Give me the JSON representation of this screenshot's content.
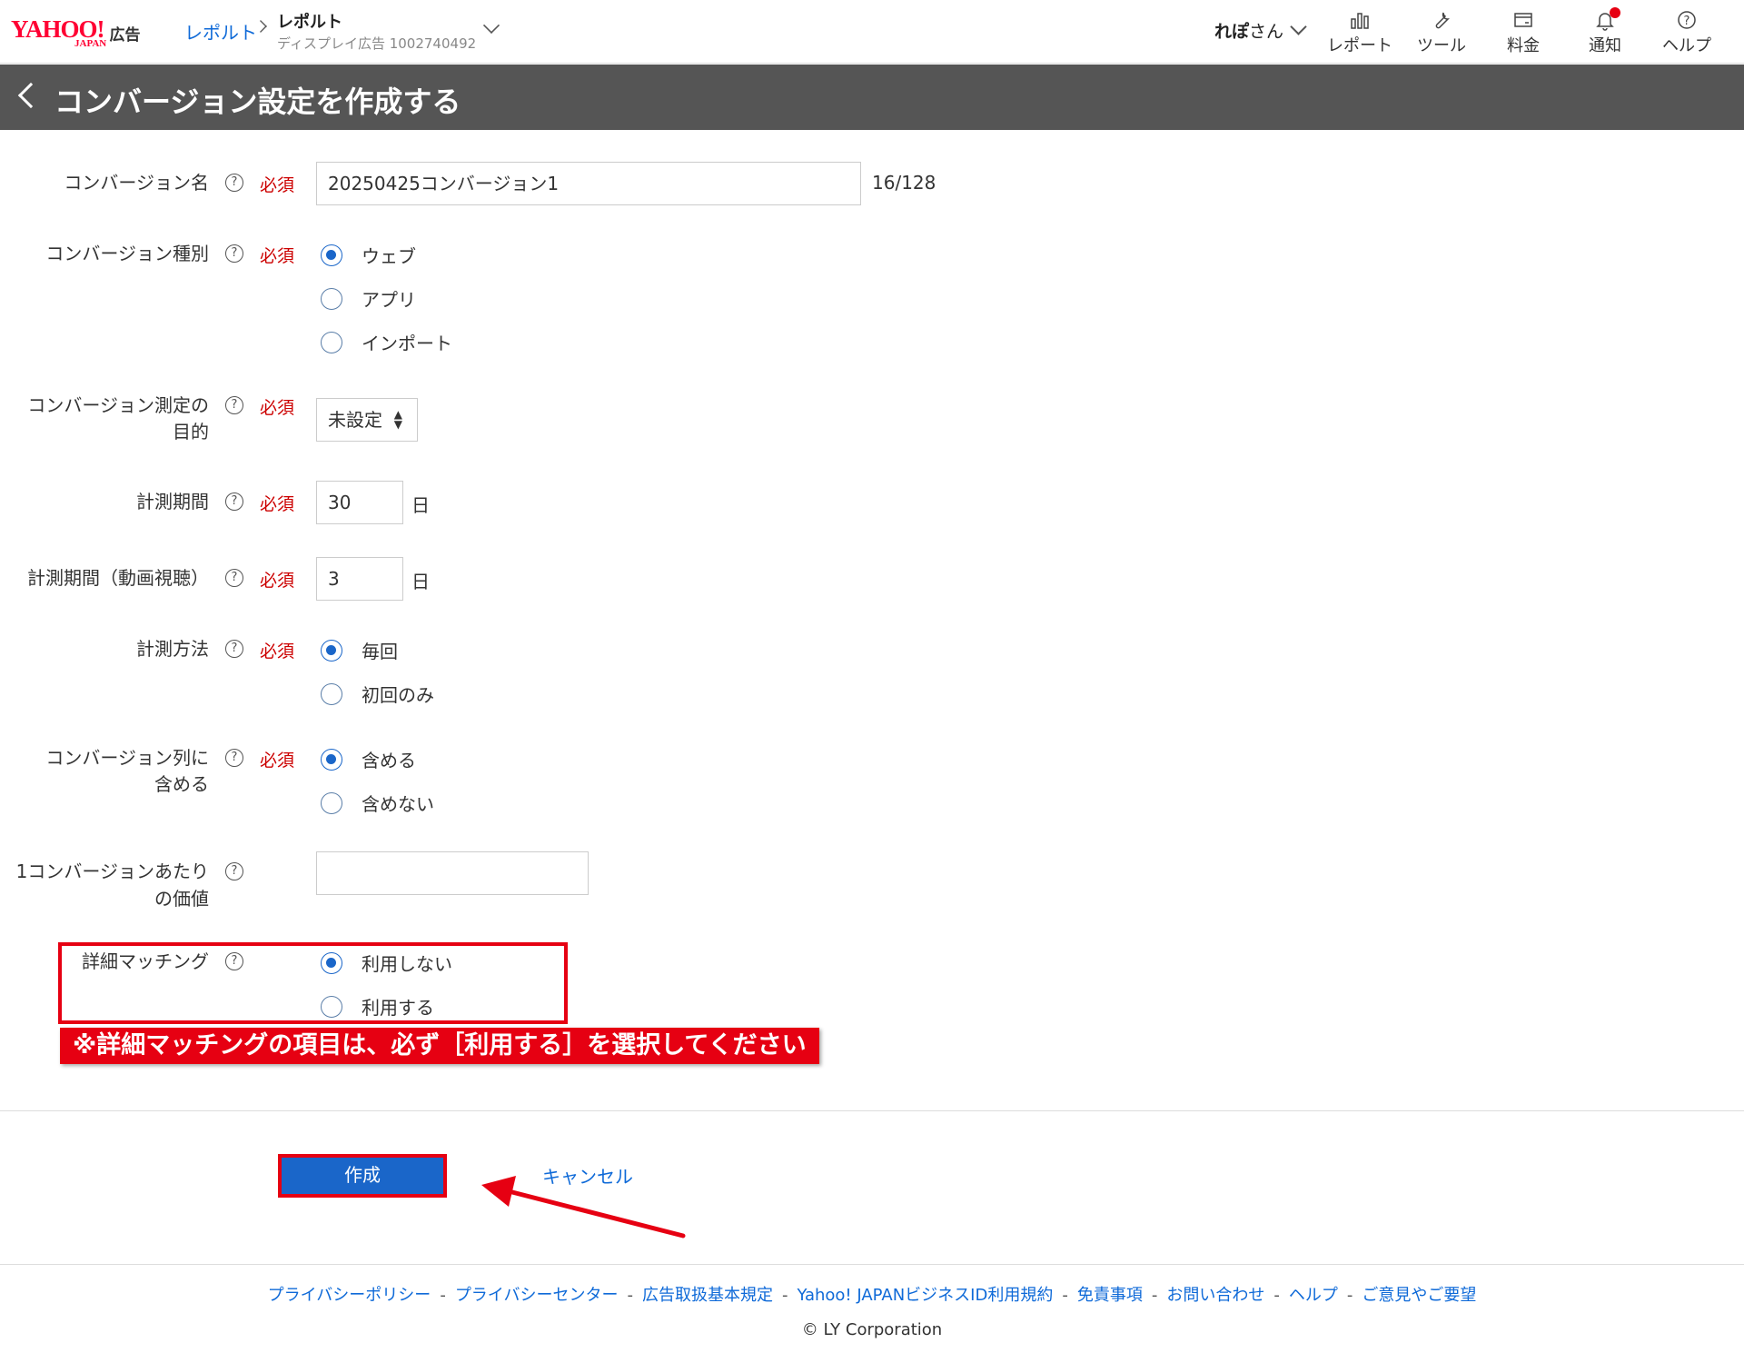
{
  "header": {
    "logo_text": "YAHOO!",
    "logo_sub": "JAPAN",
    "logo_ad": "広告",
    "breadcrumb_link": "レポルト",
    "account_title": "レポルト",
    "account_sub": "ディスプレイ広告 1002740492",
    "user_name": "れぽ",
    "user_suffix": "さん",
    "nav": [
      {
        "label": "レポート",
        "icon": "bar-chart-icon"
      },
      {
        "label": "ツール",
        "icon": "wrench-icon"
      },
      {
        "label": "料金",
        "icon": "billing-icon"
      },
      {
        "label": "通知",
        "icon": "bell-icon",
        "badge_color": "#e60012"
      },
      {
        "label": "ヘルプ",
        "icon": "question-icon"
      }
    ]
  },
  "page": {
    "title": "コンバージョン設定を作成する"
  },
  "form": {
    "required_label": "必須",
    "help_glyph": "?",
    "conversion_name": {
      "label": "コンバージョン名",
      "value": "20250425コンバージョン1",
      "counter": "16/128"
    },
    "conversion_type": {
      "label": "コンバージョン種別",
      "options": [
        "ウェブ",
        "アプリ",
        "インポート"
      ],
      "selected": "ウェブ"
    },
    "purpose": {
      "label_line1": "コンバージョン測定の",
      "label_line2": "目的",
      "selected": "未設定"
    },
    "period": {
      "label": "計測期間",
      "value": "30",
      "unit": "日"
    },
    "period_video": {
      "label": "計測期間（動画視聴）",
      "value": "3",
      "unit": "日"
    },
    "method": {
      "label": "計測方法",
      "options": [
        "毎回",
        "初回のみ"
      ],
      "selected": "毎回"
    },
    "include_column": {
      "label_line1": "コンバージョン列に",
      "label_line2": "含める",
      "options": [
        "含める",
        "含めない"
      ],
      "selected": "含める"
    },
    "value_per_conversion": {
      "label_line1": "1コンバージョンあたり",
      "label_line2": "の価値",
      "value": ""
    },
    "detailed_matching": {
      "label": "詳細マッチング",
      "options": [
        "利用しない",
        "利用する"
      ],
      "selected": "利用しない"
    }
  },
  "annotation": {
    "warning": "※詳細マッチングの項目は、必ず［利用する］を選択してください",
    "color": "#e60012"
  },
  "actions": {
    "create_label": "作成",
    "cancel_label": "キャンセル"
  },
  "footer": {
    "links": [
      "プライバシーポリシー",
      "プライバシーセンター",
      "広告取扱基本規定",
      "Yahoo! JAPANビジネスID利用規約",
      "免責事項",
      "お問い合わせ",
      "ヘルプ",
      "ご意見やご要望"
    ],
    "separator": "-",
    "copyright": "© LY Corporation"
  }
}
